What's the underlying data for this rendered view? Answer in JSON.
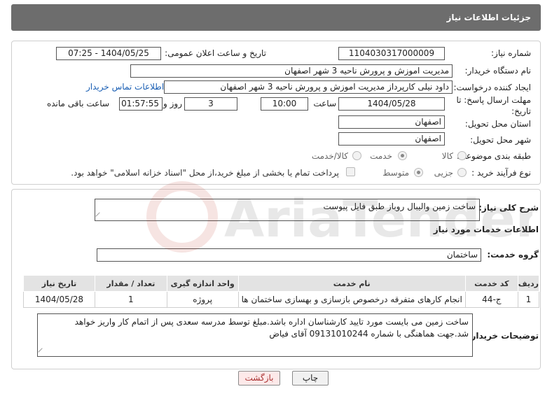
{
  "header": {
    "title": "جزئیات اطلاعات نیاز"
  },
  "form": {
    "need_number_label": "شماره نیاز:",
    "need_number": "1104030317000009",
    "announce_label": "تاریخ و ساعت اعلان عمومی:",
    "announce_value": "1404/05/25 - 07:25",
    "buyer_label": "نام دستگاه خریدار:",
    "buyer_value": "مدیریت اموزش و پرورش ناحیه 3 شهر اصفهان",
    "creator_label": "ایجاد کننده درخواست:",
    "creator_value": "داود نیلی کارپرداز مدیریت اموزش و پرورش ناحیه 3 شهر اصفهان",
    "contact_link": "اطلاعات تماس خریدار",
    "deadline_label_1": "مهلت ارسال پاسخ: تا",
    "deadline_label_2": "تاریخ:",
    "deadline_date": "1404/05/28",
    "time_label": "ساعت",
    "deadline_time": "10:00",
    "days_value": "3",
    "days_label": "روز و",
    "remaining_value": "01:57:55",
    "remaining_label": "ساعت باقی مانده",
    "province_label": "استان محل تحویل:",
    "province_value": "اصفهان",
    "city_label": "شهر محل تحویل:",
    "city_value": "اصفهان",
    "category_label": "طبقه بندی موضوعی:",
    "category_options": [
      "کالا",
      "خدمت",
      "کالا/خدمت"
    ],
    "process_label": "نوع فرآیند خرید :",
    "process_options": [
      "جزیی",
      "متوسط"
    ],
    "payment_text": "پرداخت تمام یا بخشی از مبلغ خرید،از محل \"اسناد خزانه اسلامی\" خواهد بود."
  },
  "details": {
    "summary_label": "شرح کلی نیاز:",
    "summary_value": "ساخت زمین والیبال روباز طبق فایل پیوست",
    "services_title": "اطلاعات خدمات مورد نیاز",
    "group_label": "گروه خدمت:",
    "group_value": "ساختمان",
    "table": {
      "headers": [
        "ردیف",
        "کد خدمت",
        "نام خدمت",
        "واحد اندازه گیری",
        "تعداد / مقدار",
        "تاریخ نیاز"
      ],
      "rows": [
        [
          "1",
          "ج-44",
          "انجام کارهای متفرقه درخصوص بازسازی و بهسازی ساختمان ها",
          "پروژه",
          "1",
          "1404/05/28"
        ]
      ]
    },
    "buyer_notes_label": "توضیحات خریدار:",
    "buyer_notes_value": "ساخت زمین می بایست مورد تایید کارشناسان اداره باشد.مبلغ توسط مدرسه سعدی پس از اتمام کار واریز خواهد شد.جهت هماهنگی با شماره 09131010244 آقای فیاض"
  },
  "buttons": {
    "print": "چاپ",
    "back": "بازگشت"
  },
  "watermark": {
    "text": "AriaTender.net"
  }
}
